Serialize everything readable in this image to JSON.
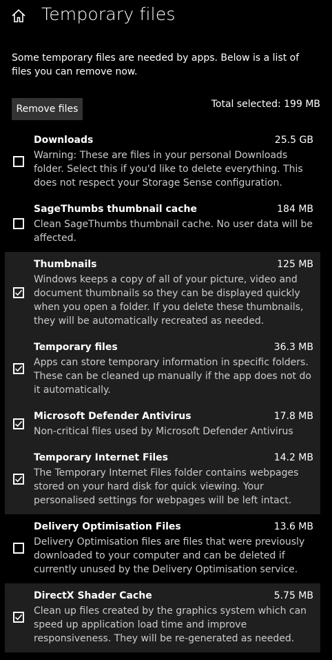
{
  "header": {
    "title": "Temporary files",
    "home_icon": "home-icon"
  },
  "intro": "Some temporary files are needed by apps. Below is a list of files you can remove now.",
  "actions": {
    "remove_label": "Remove files",
    "total_selected": "Total selected: 199 MB"
  },
  "colors": {
    "background": "#000000",
    "checked_row": "#1f1f1f",
    "button": "#333333",
    "description": "#cccccc"
  },
  "items": [
    {
      "title": "Downloads",
      "size": "25.5 GB",
      "description": "Warning: These are files in your personal Downloads folder. Select this if you'd like to delete everything. This does not respect your Storage Sense configuration.",
      "checked": false
    },
    {
      "title": "SageThumbs thumbnail cache",
      "size": "184 MB",
      "description": "Clean SageThumbs thumbnail cache. No user data will be affected.",
      "checked": false
    },
    {
      "title": "Thumbnails",
      "size": "125 MB",
      "description": "Windows keeps a copy of all of your picture, video and document thumbnails so they can be displayed quickly when you open a folder. If you delete these thumbnails, they will be automatically recreated as needed.",
      "checked": true
    },
    {
      "title": "Temporary files",
      "size": "36.3 MB",
      "description": "Apps can store temporary information in specific folders. These can be cleaned up manually if the app does not do it automatically.",
      "checked": true
    },
    {
      "title": "Microsoft Defender Antivirus",
      "size": "17.8 MB",
      "description": "Non-critical files used by Microsoft Defender Antivirus",
      "checked": true
    },
    {
      "title": "Temporary Internet Files",
      "size": "14.2 MB",
      "description": "The Temporary Internet Files folder contains webpages stored on your hard disk for quick viewing. Your personalised settings for webpages will be left intact.",
      "checked": true
    },
    {
      "title": "Delivery Optimisation Files",
      "size": "13.6 MB",
      "description": "Delivery Optimisation files are files that were previously downloaded to your computer and can be deleted if currently unused by the Delivery Optimisation service.",
      "checked": false
    },
    {
      "title": "DirectX Shader Cache",
      "size": "5.75 MB",
      "description": "Clean up files created by the graphics system which can speed up application load time and improve responsiveness. They will be re-generated as needed.",
      "checked": true
    }
  ]
}
